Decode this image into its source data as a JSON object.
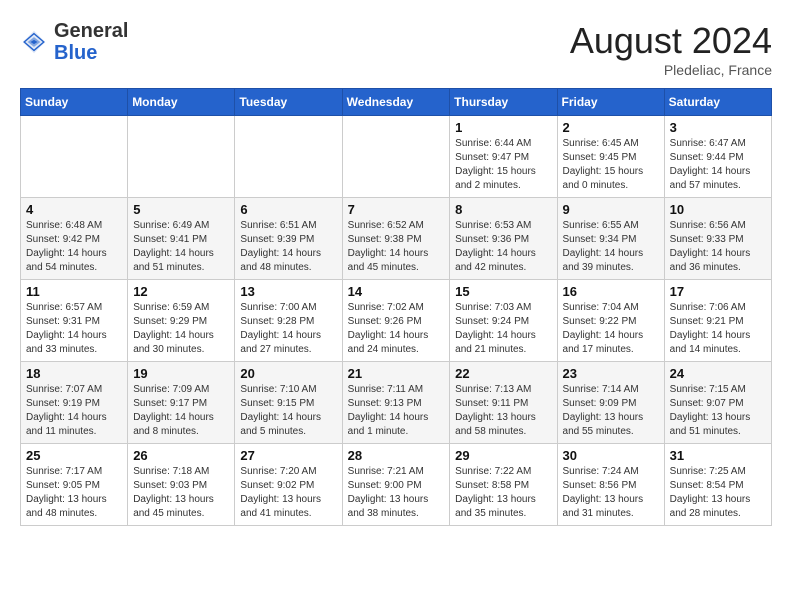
{
  "header": {
    "logo_general": "General",
    "logo_blue": "Blue",
    "month_year": "August 2024",
    "location": "Pledeliac, France"
  },
  "days_of_week": [
    "Sunday",
    "Monday",
    "Tuesday",
    "Wednesday",
    "Thursday",
    "Friday",
    "Saturday"
  ],
  "weeks": [
    [
      {
        "day": "",
        "info": ""
      },
      {
        "day": "",
        "info": ""
      },
      {
        "day": "",
        "info": ""
      },
      {
        "day": "",
        "info": ""
      },
      {
        "day": "1",
        "info": "Sunrise: 6:44 AM\nSunset: 9:47 PM\nDaylight: 15 hours\nand 2 minutes."
      },
      {
        "day": "2",
        "info": "Sunrise: 6:45 AM\nSunset: 9:45 PM\nDaylight: 15 hours\nand 0 minutes."
      },
      {
        "day": "3",
        "info": "Sunrise: 6:47 AM\nSunset: 9:44 PM\nDaylight: 14 hours\nand 57 minutes."
      }
    ],
    [
      {
        "day": "4",
        "info": "Sunrise: 6:48 AM\nSunset: 9:42 PM\nDaylight: 14 hours\nand 54 minutes."
      },
      {
        "day": "5",
        "info": "Sunrise: 6:49 AM\nSunset: 9:41 PM\nDaylight: 14 hours\nand 51 minutes."
      },
      {
        "day": "6",
        "info": "Sunrise: 6:51 AM\nSunset: 9:39 PM\nDaylight: 14 hours\nand 48 minutes."
      },
      {
        "day": "7",
        "info": "Sunrise: 6:52 AM\nSunset: 9:38 PM\nDaylight: 14 hours\nand 45 minutes."
      },
      {
        "day": "8",
        "info": "Sunrise: 6:53 AM\nSunset: 9:36 PM\nDaylight: 14 hours\nand 42 minutes."
      },
      {
        "day": "9",
        "info": "Sunrise: 6:55 AM\nSunset: 9:34 PM\nDaylight: 14 hours\nand 39 minutes."
      },
      {
        "day": "10",
        "info": "Sunrise: 6:56 AM\nSunset: 9:33 PM\nDaylight: 14 hours\nand 36 minutes."
      }
    ],
    [
      {
        "day": "11",
        "info": "Sunrise: 6:57 AM\nSunset: 9:31 PM\nDaylight: 14 hours\nand 33 minutes."
      },
      {
        "day": "12",
        "info": "Sunrise: 6:59 AM\nSunset: 9:29 PM\nDaylight: 14 hours\nand 30 minutes."
      },
      {
        "day": "13",
        "info": "Sunrise: 7:00 AM\nSunset: 9:28 PM\nDaylight: 14 hours\nand 27 minutes."
      },
      {
        "day": "14",
        "info": "Sunrise: 7:02 AM\nSunset: 9:26 PM\nDaylight: 14 hours\nand 24 minutes."
      },
      {
        "day": "15",
        "info": "Sunrise: 7:03 AM\nSunset: 9:24 PM\nDaylight: 14 hours\nand 21 minutes."
      },
      {
        "day": "16",
        "info": "Sunrise: 7:04 AM\nSunset: 9:22 PM\nDaylight: 14 hours\nand 17 minutes."
      },
      {
        "day": "17",
        "info": "Sunrise: 7:06 AM\nSunset: 9:21 PM\nDaylight: 14 hours\nand 14 minutes."
      }
    ],
    [
      {
        "day": "18",
        "info": "Sunrise: 7:07 AM\nSunset: 9:19 PM\nDaylight: 14 hours\nand 11 minutes."
      },
      {
        "day": "19",
        "info": "Sunrise: 7:09 AM\nSunset: 9:17 PM\nDaylight: 14 hours\nand 8 minutes."
      },
      {
        "day": "20",
        "info": "Sunrise: 7:10 AM\nSunset: 9:15 PM\nDaylight: 14 hours\nand 5 minutes."
      },
      {
        "day": "21",
        "info": "Sunrise: 7:11 AM\nSunset: 9:13 PM\nDaylight: 14 hours\nand 1 minute."
      },
      {
        "day": "22",
        "info": "Sunrise: 7:13 AM\nSunset: 9:11 PM\nDaylight: 13 hours\nand 58 minutes."
      },
      {
        "day": "23",
        "info": "Sunrise: 7:14 AM\nSunset: 9:09 PM\nDaylight: 13 hours\nand 55 minutes."
      },
      {
        "day": "24",
        "info": "Sunrise: 7:15 AM\nSunset: 9:07 PM\nDaylight: 13 hours\nand 51 minutes."
      }
    ],
    [
      {
        "day": "25",
        "info": "Sunrise: 7:17 AM\nSunset: 9:05 PM\nDaylight: 13 hours\nand 48 minutes."
      },
      {
        "day": "26",
        "info": "Sunrise: 7:18 AM\nSunset: 9:03 PM\nDaylight: 13 hours\nand 45 minutes."
      },
      {
        "day": "27",
        "info": "Sunrise: 7:20 AM\nSunset: 9:02 PM\nDaylight: 13 hours\nand 41 minutes."
      },
      {
        "day": "28",
        "info": "Sunrise: 7:21 AM\nSunset: 9:00 PM\nDaylight: 13 hours\nand 38 minutes."
      },
      {
        "day": "29",
        "info": "Sunrise: 7:22 AM\nSunset: 8:58 PM\nDaylight: 13 hours\nand 35 minutes."
      },
      {
        "day": "30",
        "info": "Sunrise: 7:24 AM\nSunset: 8:56 PM\nDaylight: 13 hours\nand 31 minutes."
      },
      {
        "day": "31",
        "info": "Sunrise: 7:25 AM\nSunset: 8:54 PM\nDaylight: 13 hours\nand 28 minutes."
      }
    ]
  ]
}
